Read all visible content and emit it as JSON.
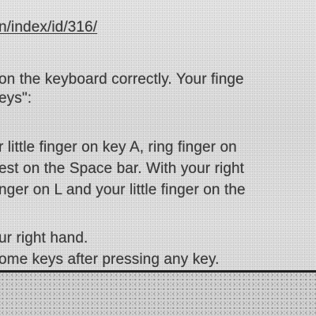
{
  "document": {
    "url_text": "n/index/id/316/",
    "lines": [
      "on the keyboard correctly. Your finge",
      "eys\":",
      "r little finger on key A, ring finger on",
      "est on the Space bar. With your right",
      "nger on L and your little finger on the",
      "ur right hand.",
      "ome keys after pressing any key."
    ]
  }
}
